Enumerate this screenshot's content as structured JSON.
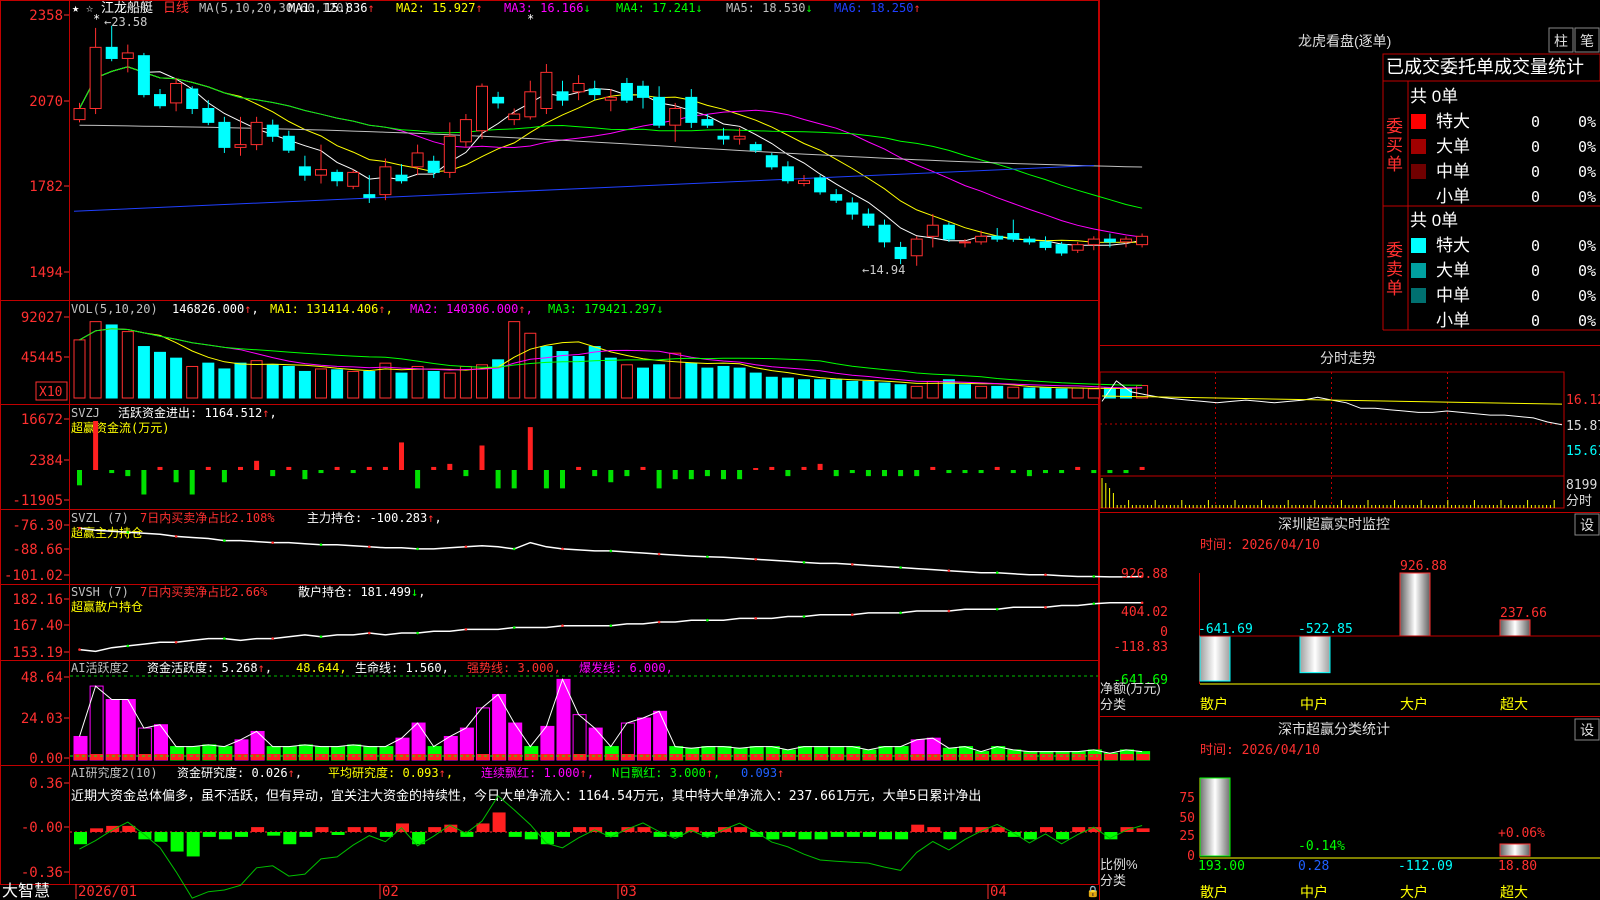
{
  "stock": {
    "name": "江龙船艇",
    "period": "日线"
  },
  "price_panel": {
    "ma_label": "MA(5,10,20,30,60,120)",
    "ma": [
      {
        "name": "MA1",
        "value": "15.836",
        "arrow": "↑",
        "color": "#ffffff"
      },
      {
        "name": "MA2",
        "value": "15.927",
        "arrow": "↑",
        "color": "#ffff00"
      },
      {
        "name": "MA3",
        "value": "16.166",
        "arrow": "↓",
        "color": "#ff00ff"
      },
      {
        "name": "MA4",
        "value": "17.241",
        "arrow": "↓",
        "color": "#00ff00"
      },
      {
        "name": "MA5",
        "value": "18.530",
        "arrow": "↓",
        "color": "#c0c0c0"
      },
      {
        "name": "MA6",
        "value": "18.250",
        "arrow": "↑",
        "color": "#2040ff"
      }
    ],
    "y_ticks": [
      "2358",
      "2070",
      "1782",
      "1494"
    ],
    "high_mark": "23.58",
    "low_mark": "14.94"
  },
  "vol_panel": {
    "label": "VOL(5,10,20)",
    "value": "146826.000",
    "ma1": "MA1: 131414.406",
    "ma2": "MA2: 140306.000",
    "ma3": "MA3: 179421.297",
    "y_ticks": [
      "92027",
      "45445"
    ],
    "unit": "X10"
  },
  "svzj_panel": {
    "label": "SVZJ",
    "title": "活跃资金进出: 1164.512",
    "subtitle": "超赢资金流(万元)",
    "y_ticks": [
      "16672",
      "2384",
      "-11905"
    ]
  },
  "svzl_panel": {
    "label": "SVZL (7)",
    "title": "7日内买卖净占比2.108%",
    "title2": "主力持仓: -100.283",
    "subtitle": "超赢主力持仓",
    "y_ticks": [
      "-76.30",
      "-88.66",
      "-101.02"
    ]
  },
  "svsh_panel": {
    "label": "SVSH (7)",
    "title": "7日内买卖净占比2.66%",
    "title2": "散户持仓: 181.499",
    "subtitle": "超赢散户持仓",
    "y_ticks": [
      "182.16",
      "167.40",
      "153.19"
    ]
  },
  "ai_active_panel": {
    "label": "AI活跃度2",
    "f1": "资金活跃度: 5.268",
    "f2": "48.644",
    "f3": "生命线: 1.560",
    "f4": "强势线: 3.000",
    "f5": "爆发线: 6.000",
    "y_ticks": [
      "48.64",
      "24.03",
      "0.00"
    ]
  },
  "ai_research_panel": {
    "label": "AI研究度2(10)",
    "f1": "资金研究度: 0.026",
    "f2": "平均研究度: 0.093",
    "f3": "连续飘红: 1.000",
    "f4": "N日飘红: 3.000",
    "f5": "0.093",
    "comment": "近期大资金总体偏多，虽不活跃，但有异动，宜关注大资金的持续性，今日大单净流入：1164.54万元，其中特大单净流入：237.661万元，大单5日累计净出",
    "y_ticks": [
      "0.36",
      "-0.00",
      "-0.36"
    ]
  },
  "x_axis": {
    "labels": [
      "2026/01",
      "02",
      "03",
      "04"
    ],
    "brand": "大智慧"
  },
  "right": {
    "lhb_title": "龙虎看盘(逐单)",
    "btn_zhu": "柱",
    "btn_bi": "笔",
    "tabs": [
      "已成交",
      "委托单",
      "成交量统计"
    ],
    "buy": {
      "side_label": "委买单",
      "total": "共 0单",
      "rows": [
        {
          "label": "特大",
          "color": "#ff0000",
          "count": "0",
          "pct": "0%"
        },
        {
          "label": "大单",
          "color": "#a00000",
          "count": "0",
          "pct": "0%"
        },
        {
          "label": "中单",
          "color": "#700000",
          "count": "0",
          "pct": "0%"
        },
        {
          "label": "小单",
          "color": "#000000",
          "count": "0",
          "pct": "0%"
        }
      ]
    },
    "sell": {
      "side_label": "委卖单",
      "total": "共 0单",
      "rows": [
        {
          "label": "特大",
          "color": "#00ffff",
          "count": "0",
          "pct": "0%"
        },
        {
          "label": "大单",
          "color": "#00a0a0",
          "count": "0",
          "pct": "0%"
        },
        {
          "label": "中单",
          "color": "#007070",
          "count": "0",
          "pct": "0%"
        },
        {
          "label": "小单",
          "color": "#000000",
          "count": "0",
          "pct": "0%"
        }
      ]
    },
    "intraday": {
      "title": "分时走势",
      "y_ticks": [
        "16.12",
        "15.87",
        "15.61"
      ],
      "vol_tick": "8199",
      "vol_label": "分时"
    },
    "monitor": {
      "title": "深圳超赢实时监控",
      "btn": "设",
      "time": "时间: 2026/04/10",
      "y_ticks": [
        "926.88",
        "404.02",
        "0",
        "-118.83",
        "-641.69"
      ],
      "y_label": "净额(万元)",
      "x_label": "分类"
    },
    "classify": {
      "title": "深市超赢分类统计",
      "btn": "设",
      "time": "时间: 2026/04/10",
      "y_ticks": [
        "75",
        "50",
        "25",
        "0"
      ],
      "y_label": "比例%",
      "x_label": "分类"
    }
  },
  "chart_data": [
    {
      "type": "candlestick",
      "title": "江龙船艇 日线",
      "x": [
        "2026/01",
        "02",
        "03",
        "04"
      ],
      "candles": [
        [
          20.2,
          20.8,
          20.1,
          20.6
        ],
        [
          20.6,
          23.5,
          20.4,
          22.8
        ],
        [
          22.8,
          23.58,
          22.3,
          22.4
        ],
        [
          22.4,
          22.9,
          21.9,
          22.6
        ],
        [
          22.5,
          22.6,
          21.0,
          21.1
        ],
        [
          21.1,
          21.3,
          20.6,
          20.7
        ],
        [
          20.8,
          21.7,
          20.5,
          21.5
        ],
        [
          21.3,
          21.4,
          20.4,
          20.6
        ],
        [
          20.6,
          20.9,
          20.0,
          20.1
        ],
        [
          20.1,
          20.3,
          19.0,
          19.2
        ],
        [
          19.2,
          20.3,
          18.9,
          19.3
        ],
        [
          19.3,
          20.3,
          19.1,
          20.1
        ],
        [
          20.0,
          20.2,
          19.4,
          19.6
        ],
        [
          19.6,
          19.8,
          19.0,
          19.1
        ],
        [
          18.5,
          18.9,
          18.0,
          18.2
        ],
        [
          18.2,
          19.3,
          17.9,
          18.4
        ],
        [
          18.3,
          18.4,
          17.8,
          18.0
        ],
        [
          17.8,
          18.4,
          17.7,
          18.3
        ],
        [
          17.5,
          18.2,
          17.2,
          17.4
        ],
        [
          17.5,
          18.8,
          17.3,
          18.5
        ],
        [
          18.2,
          18.6,
          17.9,
          18.0
        ],
        [
          18.5,
          19.3,
          18.2,
          19.0
        ],
        [
          18.7,
          18.9,
          18.1,
          18.3
        ],
        [
          18.3,
          20.1,
          18.1,
          19.6
        ],
        [
          19.4,
          20.4,
          19.2,
          20.2
        ],
        [
          19.8,
          21.5,
          19.5,
          21.4
        ],
        [
          21.0,
          21.2,
          20.6,
          20.8
        ],
        [
          20.2,
          20.6,
          20.0,
          20.4
        ],
        [
          20.3,
          21.6,
          20.2,
          21.2
        ],
        [
          20.6,
          22.2,
          20.4,
          21.9
        ],
        [
          21.2,
          21.6,
          20.7,
          20.9
        ],
        [
          21.2,
          21.8,
          20.9,
          21.5
        ],
        [
          21.3,
          21.6,
          20.9,
          21.1
        ],
        [
          20.9,
          21.3,
          20.5,
          21.0
        ],
        [
          21.5,
          21.7,
          20.8,
          20.9
        ],
        [
          21.4,
          21.6,
          20.6,
          21.0
        ],
        [
          21.0,
          21.4,
          19.9,
          20.0
        ],
        [
          20.0,
          20.8,
          19.4,
          20.6
        ],
        [
          21.0,
          21.3,
          19.9,
          20.1
        ],
        [
          20.2,
          20.4,
          19.9,
          20.0
        ],
        [
          19.6,
          19.9,
          19.3,
          19.5
        ],
        [
          19.5,
          19.9,
          19.3,
          19.6
        ],
        [
          19.3,
          19.4,
          19.0,
          19.1
        ],
        [
          18.9,
          19.0,
          18.4,
          18.5
        ],
        [
          18.5,
          18.7,
          17.9,
          18.0
        ],
        [
          17.9,
          18.2,
          17.8,
          18.0
        ],
        [
          18.1,
          18.2,
          17.5,
          17.6
        ],
        [
          17.5,
          17.7,
          17.2,
          17.3
        ],
        [
          17.2,
          17.4,
          16.6,
          16.8
        ],
        [
          16.8,
          17.0,
          16.3,
          16.4
        ],
        [
          16.4,
          16.6,
          15.6,
          15.8
        ],
        [
          15.6,
          15.8,
          15.0,
          15.2
        ],
        [
          15.3,
          16.0,
          14.94,
          15.9
        ],
        [
          16.0,
          16.8,
          15.6,
          16.4
        ],
        [
          16.4,
          16.5,
          15.8,
          15.9
        ],
        [
          15.8,
          15.9,
          15.6,
          15.8
        ],
        [
          15.8,
          16.2,
          15.7,
          16.0
        ],
        [
          16.0,
          16.3,
          15.8,
          15.9
        ],
        [
          16.1,
          16.6,
          15.8,
          15.9
        ],
        [
          15.9,
          16.0,
          15.7,
          15.8
        ],
        [
          15.8,
          16.0,
          15.5,
          15.6
        ],
        [
          15.7,
          15.8,
          15.3,
          15.4
        ],
        [
          15.5,
          15.8,
          15.4,
          15.7
        ],
        [
          15.7,
          16.0,
          15.5,
          15.9
        ],
        [
          15.9,
          16.1,
          15.6,
          15.8
        ],
        [
          15.8,
          16.0,
          15.6,
          15.9
        ],
        [
          15.7,
          16.1,
          15.6,
          16.0
        ]
      ],
      "ylim": [
        14.5,
        24.0
      ]
    },
    {
      "type": "bar",
      "title": "VOL(5,10,20)",
      "values": [
        70,
        92,
        88,
        80,
        62,
        55,
        48,
        38,
        42,
        35,
        42,
        45,
        40,
        38,
        32,
        35,
        34,
        32,
        32,
        42,
        30,
        38,
        32,
        30,
        38,
        40,
        46,
        92,
        78,
        62,
        56,
        50,
        62,
        48,
        40,
        36,
        40,
        54,
        42,
        36,
        38,
        36,
        30,
        25,
        24,
        22,
        22,
        22,
        20,
        20,
        18,
        16,
        14,
        20,
        22,
        16,
        14,
        14,
        13,
        12,
        12,
        11,
        12,
        11,
        12,
        11,
        15
      ],
      "up": [
        1,
        1,
        0,
        1,
        0,
        0,
        0,
        1,
        0,
        0,
        0,
        1,
        0,
        0,
        0,
        1,
        0,
        1,
        0,
        1,
        0,
        1,
        0,
        1,
        1,
        1,
        0,
        1,
        1,
        0,
        0,
        0,
        0,
        0,
        1,
        0,
        0,
        1,
        0,
        0,
        0,
        0,
        0,
        0,
        0,
        0,
        0,
        0,
        0,
        0,
        0,
        0,
        1,
        1,
        0,
        0,
        1,
        0,
        1,
        0,
        0,
        0,
        1,
        1,
        0,
        0,
        1
      ],
      "ylim": [
        0,
        100
      ]
    },
    {
      "type": "bar",
      "title": "活跃资金进出",
      "values": [
        -5,
        16,
        -1,
        -2,
        -8,
        1,
        -4,
        -8,
        1,
        -4,
        1,
        3,
        -2,
        1,
        -3,
        -1,
        1,
        -1,
        1,
        1,
        9,
        -6,
        1,
        2,
        -2,
        8,
        -6,
        -6,
        14,
        -6,
        -6,
        1,
        -2,
        -4,
        -2,
        1,
        -6,
        -3,
        -3,
        -2,
        -3,
        -3,
        0,
        1,
        -2,
        1,
        2,
        -2,
        -1,
        -2,
        -2,
        -2,
        -2,
        1,
        -1,
        -1,
        -1,
        1,
        -1,
        -2,
        -1,
        -1,
        1,
        -1,
        -1,
        -1,
        1
      ],
      "ylim": [
        -11.905,
        16.672
      ]
    },
    {
      "type": "line",
      "title": "超赢主力持仓",
      "values": [
        -77,
        -78,
        -78.5,
        -79,
        -79.5,
        -80,
        -81,
        -81.5,
        -82,
        -83,
        -83,
        -83.5,
        -84,
        -84,
        -84.5,
        -85,
        -85,
        -85.5,
        -86,
        -86.5,
        -86.5,
        -87,
        -87,
        -86.5,
        -86,
        -85.5,
        -86,
        -87,
        -84,
        -86,
        -87,
        -87.5,
        -88,
        -88,
        -88.5,
        -89,
        -89.5,
        -90,
        -90.5,
        -90.8,
        -91,
        -91.5,
        -92,
        -92.5,
        -93,
        -93.5,
        -94,
        -94,
        -94.5,
        -95,
        -95.5,
        -96,
        -96.5,
        -97,
        -97.5,
        -98,
        -98.5,
        -98.5,
        -99,
        -99.5,
        -99.5,
        -100,
        -100.3,
        -100.3,
        -100.5,
        -100.5,
        -100.3
      ],
      "ylim": [
        -102,
        -75.5
      ]
    },
    {
      "type": "line",
      "title": "超赢散户持仓",
      "values": [
        156,
        155,
        157,
        158,
        159,
        160,
        160,
        161,
        162,
        162,
        161,
        162,
        162,
        163,
        164,
        163,
        164,
        164,
        165,
        164,
        165,
        165,
        166,
        166,
        167,
        167,
        167,
        168,
        168,
        168,
        169,
        169,
        169,
        169,
        170,
        170,
        171,
        171,
        172,
        172,
        172,
        173,
        173,
        173,
        174,
        174,
        175,
        175,
        175,
        176,
        176,
        176,
        177,
        177,
        177,
        178,
        178,
        178,
        179,
        179,
        179,
        180,
        180,
        181,
        181.5,
        181.5,
        181.5
      ],
      "ylim": [
        152.5,
        183
      ]
    },
    {
      "type": "bar",
      "title": "AI活跃度2",
      "values": [
        14,
        44,
        36,
        36,
        19,
        21,
        8,
        8,
        9,
        8,
        12,
        17,
        8,
        8,
        9,
        8,
        8,
        9,
        8,
        8,
        13,
        22,
        8,
        14,
        19,
        31,
        39,
        22,
        8,
        20,
        48,
        27,
        19,
        8,
        22,
        25,
        29,
        8,
        7,
        8,
        8,
        7,
        8,
        8,
        6,
        8,
        8,
        8,
        8,
        6,
        8,
        8,
        12,
        13,
        7,
        8,
        5,
        8,
        6,
        5,
        5,
        5,
        5,
        6,
        4,
        6,
        5
      ],
      "ylim": [
        0,
        50
      ]
    },
    {
      "type": "bar",
      "title": "AI研究度2(10)",
      "values": [
        -0.1,
        0.03,
        0.05,
        0.05,
        -0.06,
        -0.08,
        -0.16,
        -0.2,
        -0.04,
        -0.06,
        -0.04,
        0.04,
        -0.03,
        -0.1,
        -0.04,
        0.04,
        -0.02,
        0.04,
        0.04,
        -0.04,
        0.07,
        -0.1,
        0.04,
        0.06,
        -0.04,
        0.07,
        0.16,
        -0.04,
        -0.06,
        -0.1,
        -0.04,
        0.04,
        0.04,
        -0.04,
        0.04,
        0.04,
        -0.04,
        -0.04,
        0.04,
        -0.04,
        0.04,
        0.04,
        -0.04,
        -0.06,
        -0.04,
        -0.06,
        -0.06,
        -0.04,
        -0.04,
        -0.04,
        -0.06,
        -0.06,
        0.06,
        0.04,
        -0.06,
        0.04,
        0.04,
        0.04,
        -0.04,
        -0.06,
        0.04,
        -0.06,
        0.04,
        0.04,
        -0.06,
        0.04,
        0.03
      ],
      "ylim": [
        -0.36,
        0.36
      ]
    },
    {
      "type": "line",
      "title": "分时走势",
      "values": [
        16.05,
        16.2,
        16.12,
        16.1,
        16.08,
        16.07,
        16.06,
        16.05,
        16.04,
        16.05,
        16.06,
        16.05,
        16.04,
        16.05,
        16.06,
        16.08,
        16.06,
        16.04,
        16.0,
        16.0,
        15.99,
        15.98,
        15.97,
        15.97,
        15.98,
        15.97,
        15.96,
        15.95,
        15.95,
        15.94,
        15.93,
        15.9,
        15.88
      ],
      "ylim": [
        15.55,
        16.25
      ]
    },
    {
      "type": "bar",
      "title": "深圳超赢实时监控",
      "categories": [
        "散户",
        "中户",
        "大户",
        "超大"
      ],
      "values": [
        -641.69,
        -522.85,
        926.88,
        237.66
      ],
      "ylim": [
        -641.69,
        926.88
      ]
    },
    {
      "type": "bar",
      "title": "深市超赢分类统计",
      "categories": [
        "散户",
        "中户",
        "大户",
        "超大"
      ],
      "values": [
        193.0,
        0.28,
        -112.09,
        18.8
      ],
      "labels": [
        "",
        "-0.14%",
        "",
        "+0.06%"
      ],
      "ylim": [
        0,
        100
      ]
    }
  ]
}
